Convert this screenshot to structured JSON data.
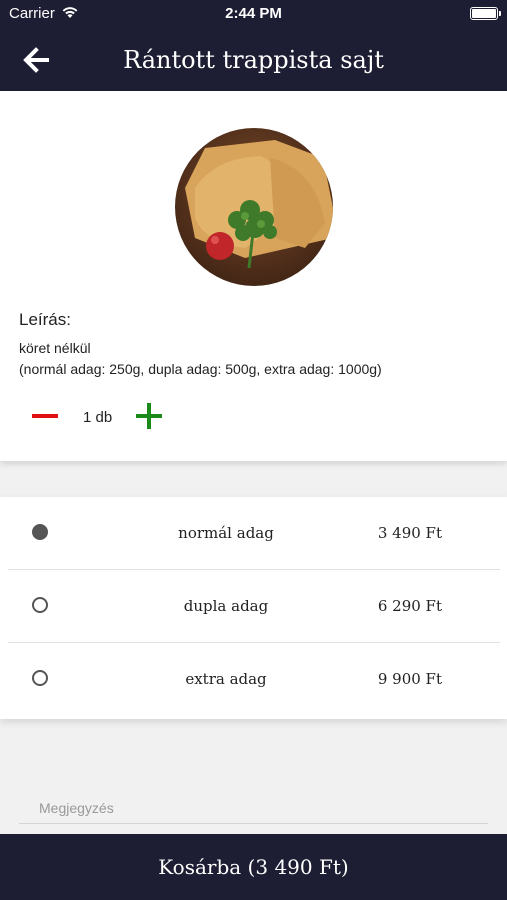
{
  "status_bar": {
    "carrier": "Carrier",
    "time": "2:44 PM"
  },
  "header": {
    "title": "Rántott trappista sajt",
    "back_icon": "arrow-left-icon"
  },
  "product": {
    "description_label": "Leírás:",
    "description_lines": [
      "köret nélkül",
      "(normál adag: 250g, dupla adag: 500g, extra adag: 1000g)"
    ],
    "quantity": "1 db"
  },
  "options": [
    {
      "name": "normál adag",
      "price": "3 490 Ft",
      "selected": true
    },
    {
      "name": "dupla adag",
      "price": "6 290 Ft",
      "selected": false
    },
    {
      "name": "extra adag",
      "price": "9 900 Ft",
      "selected": false
    }
  ],
  "note": {
    "placeholder": "Megjegyzés",
    "value": ""
  },
  "cart_button": {
    "label": "Kosárba (3 490 Ft)"
  },
  "colors": {
    "bar_background": "#1d1d33",
    "minus": "#e01010",
    "plus": "#1a8a1a",
    "radio": "#555555"
  }
}
